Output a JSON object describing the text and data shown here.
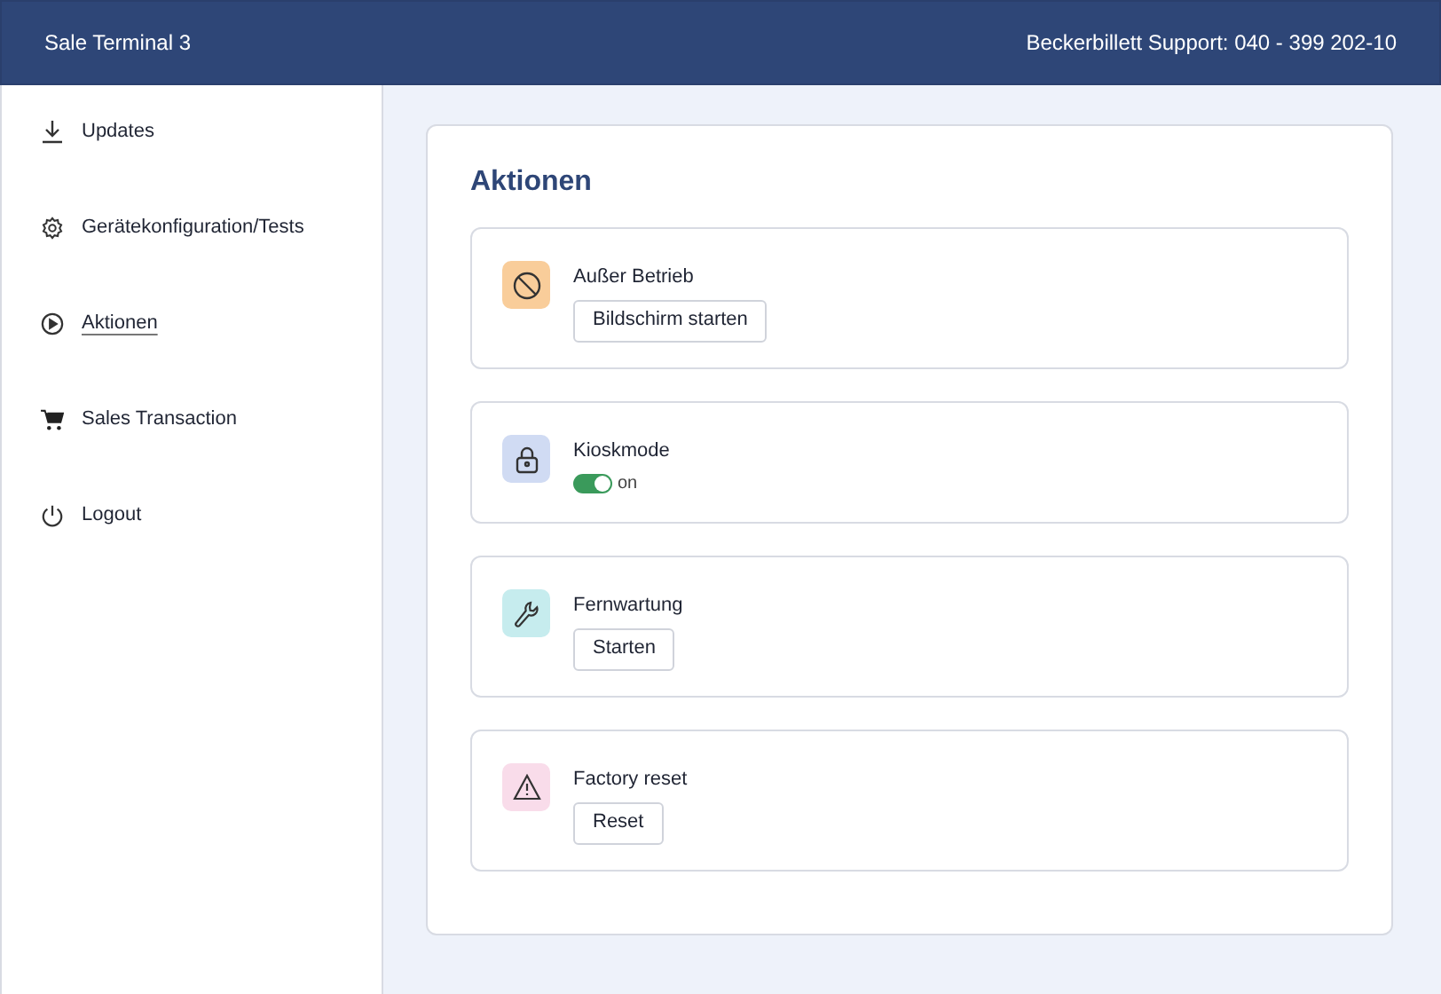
{
  "header": {
    "title": "Sale Terminal 3",
    "support": "Beckerbillett Support: 040 - 399 202-10"
  },
  "sidebar": {
    "items": [
      {
        "label": "Updates",
        "selected": false
      },
      {
        "label": "Gerätekonfiguration/Tests",
        "selected": false
      },
      {
        "label": "Aktionen",
        "selected": true
      },
      {
        "label": "Sales Transaction",
        "selected": false
      },
      {
        "label": "Logout",
        "selected": false
      }
    ]
  },
  "panel": {
    "title": "Aktionen",
    "actions": [
      {
        "kind": "button",
        "title": "Außer Betrieb",
        "color": "#f9cd9a",
        "button": "Bildschirm starten"
      },
      {
        "kind": "toggle",
        "title": "Kioskmode",
        "color": "#d0dbf3",
        "on": true,
        "state_label": "on"
      },
      {
        "kind": "button",
        "title": "Fernwartung",
        "color": "#c6ecee",
        "button": "Starten"
      },
      {
        "kind": "button",
        "title": "Factory reset",
        "color": "#f9dcea",
        "button": "Reset"
      }
    ]
  }
}
